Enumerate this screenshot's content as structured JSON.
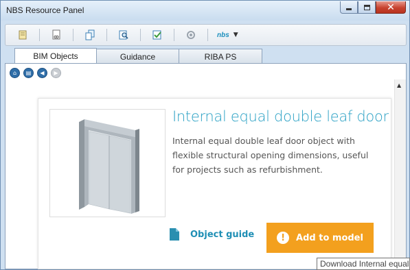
{
  "window": {
    "title": "NBS Resource Panel",
    "controls": {
      "minimize": "minimize-icon",
      "maximize": "maximize-icon",
      "close": "close-icon"
    }
  },
  "toolbar": {
    "icons": [
      "notes-icon",
      "link-document-icon",
      "documents-icon",
      "search-document-icon",
      "check-document-icon",
      "sync-icon"
    ],
    "nbs_menu_label": "nbs"
  },
  "tabs": [
    {
      "label": "BIM Objects",
      "active": true
    },
    {
      "label": "Guidance",
      "active": false
    },
    {
      "label": "RIBA PS",
      "active": false
    }
  ],
  "nav": {
    "buttons": [
      {
        "icon": "home-icon",
        "enabled": true
      },
      {
        "icon": "chart-icon",
        "enabled": true
      },
      {
        "icon": "back-icon",
        "enabled": true
      },
      {
        "icon": "forward-icon",
        "enabled": false
      }
    ]
  },
  "object": {
    "title": "Internal equal double leaf door",
    "description": "Internal equal double leaf door object with flexible structural opening dimensions, useful for projects such as refurbishment.",
    "guide_label": "Object guide",
    "add_label": "Add to model"
  },
  "tooltip": "Download Internal equal",
  "colors": {
    "accent_blue": "#29a0c4",
    "button_orange": "#f3a01e",
    "nav_blue": "#2f6ea8"
  }
}
